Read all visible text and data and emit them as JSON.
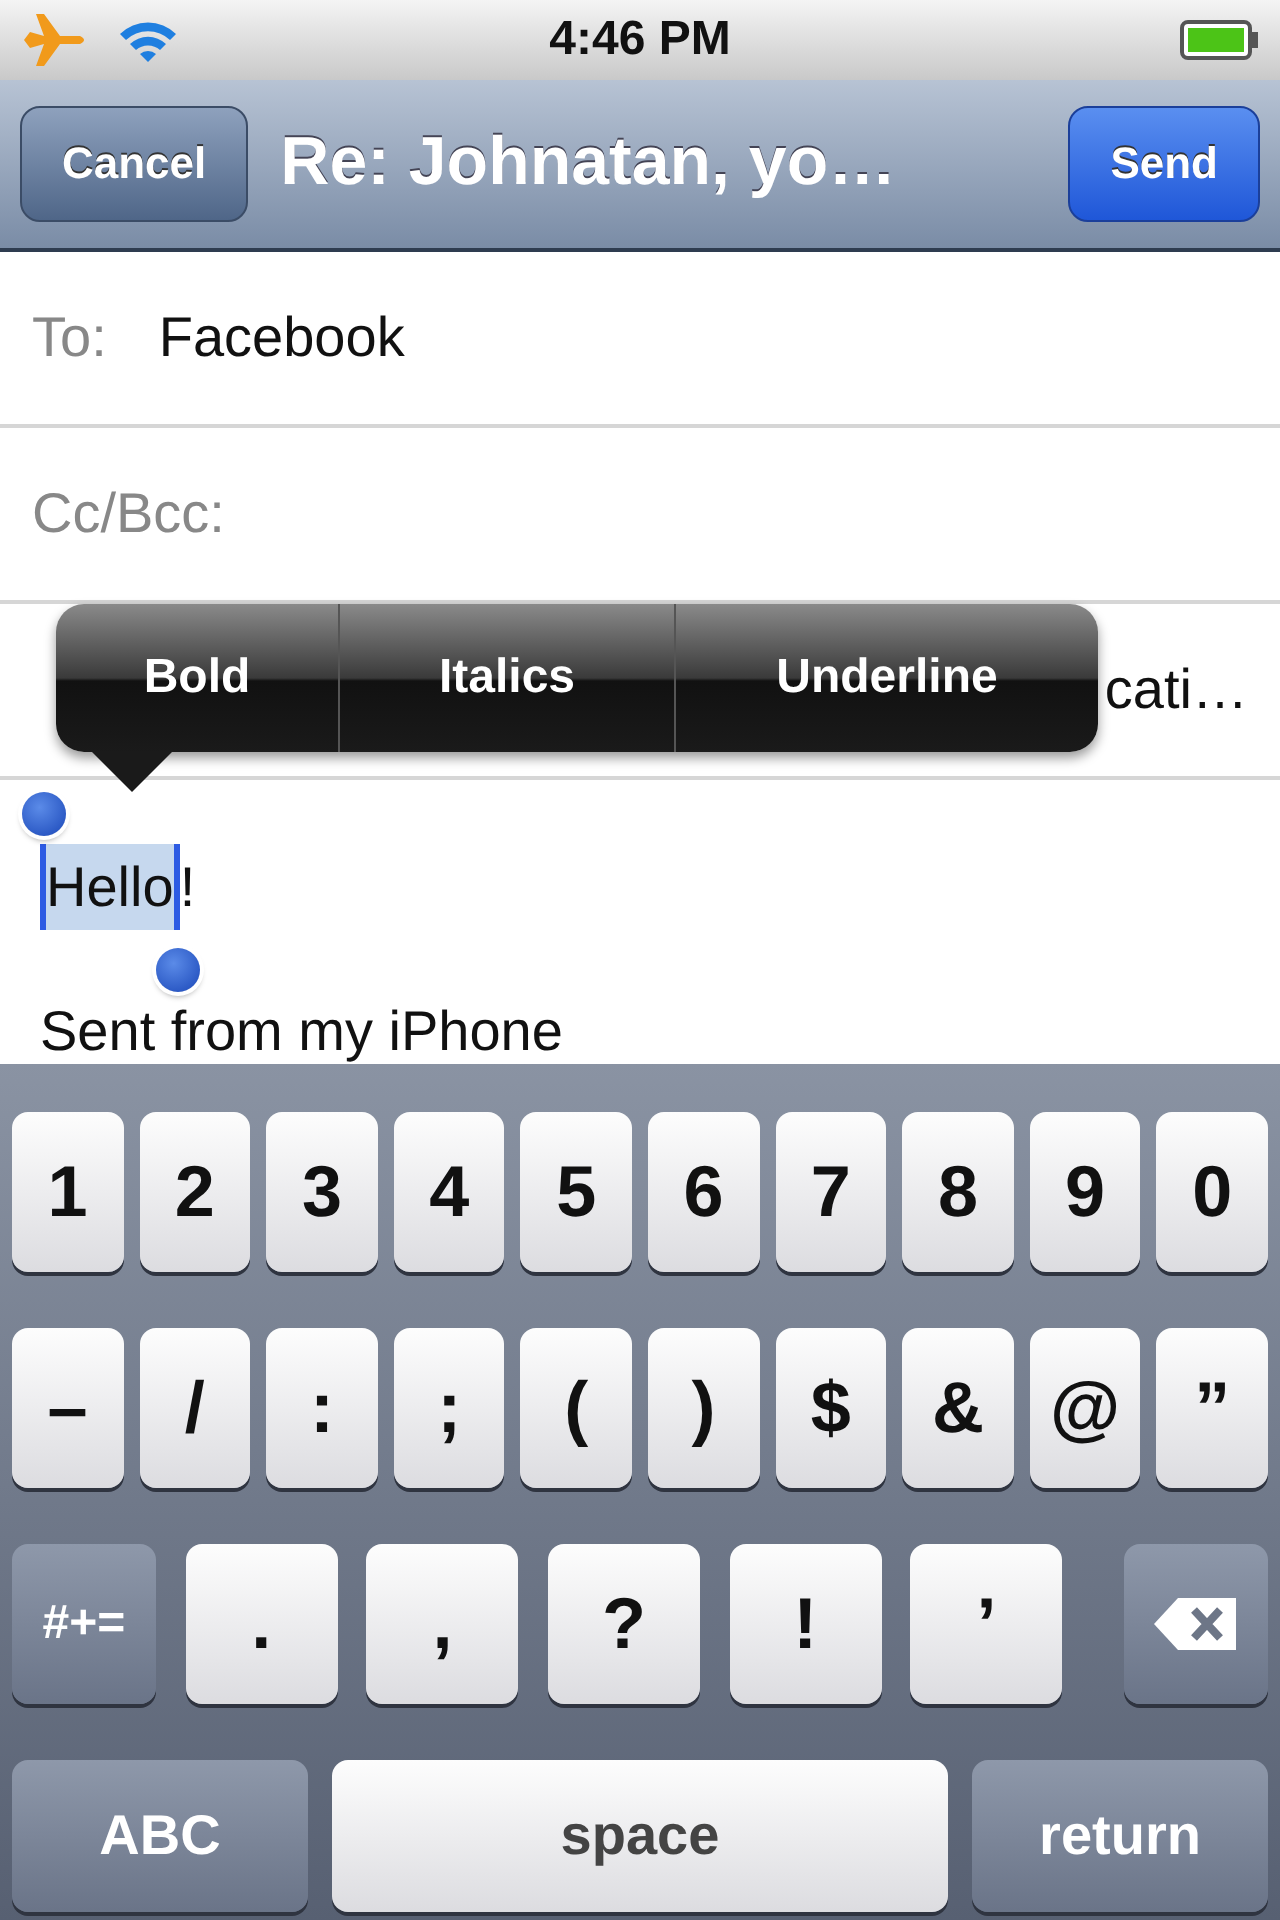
{
  "status_bar": {
    "time": "4:46 PM"
  },
  "nav_bar": {
    "cancel": "Cancel",
    "title": "Re: Johnatan, yo…",
    "send": "Send"
  },
  "fields": [
    {
      "kind": "to",
      "label": "To:",
      "value": "Facebook"
    },
    {
      "kind": "cc",
      "label": "Cc/Bcc:"
    },
    {
      "kind": "subject",
      "value": "cati…"
    }
  ],
  "format_menu": {
    "items": [
      {
        "label": "Bold"
      },
      {
        "label": "Italics"
      },
      {
        "label": "Underline"
      }
    ]
  },
  "body": {
    "segments": [
      {
        "text": "Hello",
        "selected": true
      },
      {
        "text": "!",
        "selected": false
      }
    ],
    "signature": "Sent from my iPhone"
  },
  "keyboard": {
    "number_keys": [
      {
        "kind": "char",
        "label": "1"
      },
      {
        "kind": "char",
        "label": "2"
      },
      {
        "kind": "char",
        "label": "3"
      },
      {
        "kind": "char",
        "label": "4"
      },
      {
        "kind": "char",
        "label": "5"
      },
      {
        "kind": "char",
        "label": "6"
      },
      {
        "kind": "char",
        "label": "7"
      },
      {
        "kind": "char",
        "label": "8"
      },
      {
        "kind": "char",
        "label": "9"
      },
      {
        "kind": "char",
        "label": "0"
      }
    ],
    "symbol_keys": [
      {
        "kind": "char",
        "label": "–"
      },
      {
        "kind": "char",
        "label": "/"
      },
      {
        "kind": "char",
        "label": ":"
      },
      {
        "kind": "char",
        "label": ";"
      },
      {
        "kind": "char",
        "label": "("
      },
      {
        "kind": "char",
        "label": ")"
      },
      {
        "kind": "char",
        "label": "$"
      },
      {
        "kind": "char",
        "label": "&"
      },
      {
        "kind": "char",
        "label": "@"
      },
      {
        "kind": "char",
        "label": "”"
      }
    ],
    "punctuation_keys": [
      {
        "kind": "mod",
        "label": "#+="
      },
      {
        "kind": "wide",
        "label": "."
      },
      {
        "kind": "wide",
        "label": ","
      },
      {
        "kind": "wide",
        "label": "?"
      },
      {
        "kind": "wide",
        "label": "!"
      },
      {
        "kind": "wide",
        "label": "’"
      },
      {
        "kind": "delete"
      }
    ],
    "bottom_keys": [
      {
        "kind": "mod-large",
        "label": "ABC"
      },
      {
        "kind": "space",
        "label": "space"
      },
      {
        "kind": "mod-large",
        "label": "return"
      }
    ]
  }
}
